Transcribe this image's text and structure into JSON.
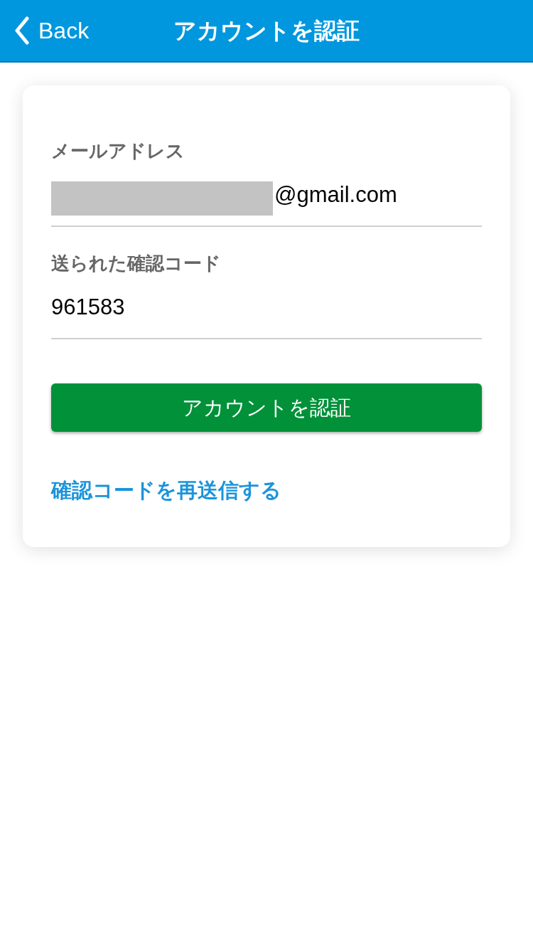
{
  "header": {
    "back": "Back",
    "title": "アカウントを認証"
  },
  "fields": [
    {
      "label": "メールアドレス",
      "value": "@gmail.com",
      "redacted": true
    },
    {
      "label": "送られた確認コード",
      "value": "961583",
      "redacted": false
    }
  ],
  "submit_button": "アカウントを認証",
  "resend_link": "確認コードを再送信する"
}
